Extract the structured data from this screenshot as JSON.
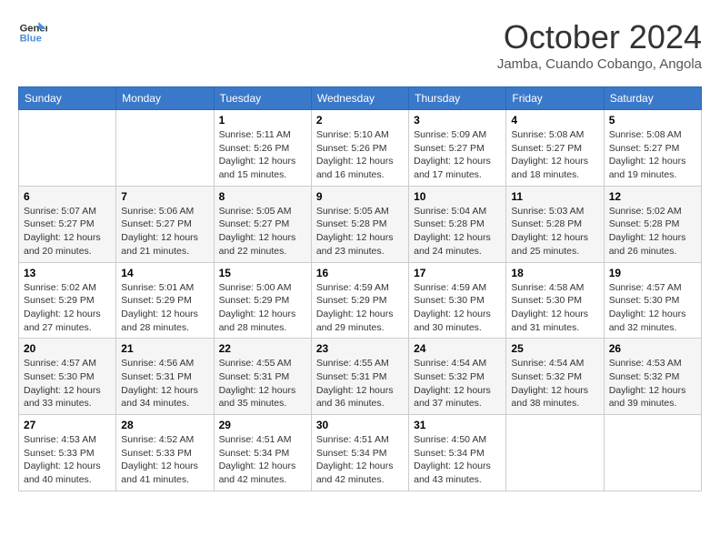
{
  "header": {
    "logo_line1": "General",
    "logo_line2": "Blue",
    "month": "October 2024",
    "location": "Jamba, Cuando Cobango, Angola"
  },
  "weekdays": [
    "Sunday",
    "Monday",
    "Tuesday",
    "Wednesday",
    "Thursday",
    "Friday",
    "Saturday"
  ],
  "weeks": [
    [
      {
        "day": "",
        "info": ""
      },
      {
        "day": "",
        "info": ""
      },
      {
        "day": "1",
        "info": "Sunrise: 5:11 AM\nSunset: 5:26 PM\nDaylight: 12 hours and 15 minutes."
      },
      {
        "day": "2",
        "info": "Sunrise: 5:10 AM\nSunset: 5:26 PM\nDaylight: 12 hours and 16 minutes."
      },
      {
        "day": "3",
        "info": "Sunrise: 5:09 AM\nSunset: 5:27 PM\nDaylight: 12 hours and 17 minutes."
      },
      {
        "day": "4",
        "info": "Sunrise: 5:08 AM\nSunset: 5:27 PM\nDaylight: 12 hours and 18 minutes."
      },
      {
        "day": "5",
        "info": "Sunrise: 5:08 AM\nSunset: 5:27 PM\nDaylight: 12 hours and 19 minutes."
      }
    ],
    [
      {
        "day": "6",
        "info": "Sunrise: 5:07 AM\nSunset: 5:27 PM\nDaylight: 12 hours and 20 minutes."
      },
      {
        "day": "7",
        "info": "Sunrise: 5:06 AM\nSunset: 5:27 PM\nDaylight: 12 hours and 21 minutes."
      },
      {
        "day": "8",
        "info": "Sunrise: 5:05 AM\nSunset: 5:27 PM\nDaylight: 12 hours and 22 minutes."
      },
      {
        "day": "9",
        "info": "Sunrise: 5:05 AM\nSunset: 5:28 PM\nDaylight: 12 hours and 23 minutes."
      },
      {
        "day": "10",
        "info": "Sunrise: 5:04 AM\nSunset: 5:28 PM\nDaylight: 12 hours and 24 minutes."
      },
      {
        "day": "11",
        "info": "Sunrise: 5:03 AM\nSunset: 5:28 PM\nDaylight: 12 hours and 25 minutes."
      },
      {
        "day": "12",
        "info": "Sunrise: 5:02 AM\nSunset: 5:28 PM\nDaylight: 12 hours and 26 minutes."
      }
    ],
    [
      {
        "day": "13",
        "info": "Sunrise: 5:02 AM\nSunset: 5:29 PM\nDaylight: 12 hours and 27 minutes."
      },
      {
        "day": "14",
        "info": "Sunrise: 5:01 AM\nSunset: 5:29 PM\nDaylight: 12 hours and 28 minutes."
      },
      {
        "day": "15",
        "info": "Sunrise: 5:00 AM\nSunset: 5:29 PM\nDaylight: 12 hours and 28 minutes."
      },
      {
        "day": "16",
        "info": "Sunrise: 4:59 AM\nSunset: 5:29 PM\nDaylight: 12 hours and 29 minutes."
      },
      {
        "day": "17",
        "info": "Sunrise: 4:59 AM\nSunset: 5:30 PM\nDaylight: 12 hours and 30 minutes."
      },
      {
        "day": "18",
        "info": "Sunrise: 4:58 AM\nSunset: 5:30 PM\nDaylight: 12 hours and 31 minutes."
      },
      {
        "day": "19",
        "info": "Sunrise: 4:57 AM\nSunset: 5:30 PM\nDaylight: 12 hours and 32 minutes."
      }
    ],
    [
      {
        "day": "20",
        "info": "Sunrise: 4:57 AM\nSunset: 5:30 PM\nDaylight: 12 hours and 33 minutes."
      },
      {
        "day": "21",
        "info": "Sunrise: 4:56 AM\nSunset: 5:31 PM\nDaylight: 12 hours and 34 minutes."
      },
      {
        "day": "22",
        "info": "Sunrise: 4:55 AM\nSunset: 5:31 PM\nDaylight: 12 hours and 35 minutes."
      },
      {
        "day": "23",
        "info": "Sunrise: 4:55 AM\nSunset: 5:31 PM\nDaylight: 12 hours and 36 minutes."
      },
      {
        "day": "24",
        "info": "Sunrise: 4:54 AM\nSunset: 5:32 PM\nDaylight: 12 hours and 37 minutes."
      },
      {
        "day": "25",
        "info": "Sunrise: 4:54 AM\nSunset: 5:32 PM\nDaylight: 12 hours and 38 minutes."
      },
      {
        "day": "26",
        "info": "Sunrise: 4:53 AM\nSunset: 5:32 PM\nDaylight: 12 hours and 39 minutes."
      }
    ],
    [
      {
        "day": "27",
        "info": "Sunrise: 4:53 AM\nSunset: 5:33 PM\nDaylight: 12 hours and 40 minutes."
      },
      {
        "day": "28",
        "info": "Sunrise: 4:52 AM\nSunset: 5:33 PM\nDaylight: 12 hours and 41 minutes."
      },
      {
        "day": "29",
        "info": "Sunrise: 4:51 AM\nSunset: 5:34 PM\nDaylight: 12 hours and 42 minutes."
      },
      {
        "day": "30",
        "info": "Sunrise: 4:51 AM\nSunset: 5:34 PM\nDaylight: 12 hours and 42 minutes."
      },
      {
        "day": "31",
        "info": "Sunrise: 4:50 AM\nSunset: 5:34 PM\nDaylight: 12 hours and 43 minutes."
      },
      {
        "day": "",
        "info": ""
      },
      {
        "day": "",
        "info": ""
      }
    ]
  ]
}
